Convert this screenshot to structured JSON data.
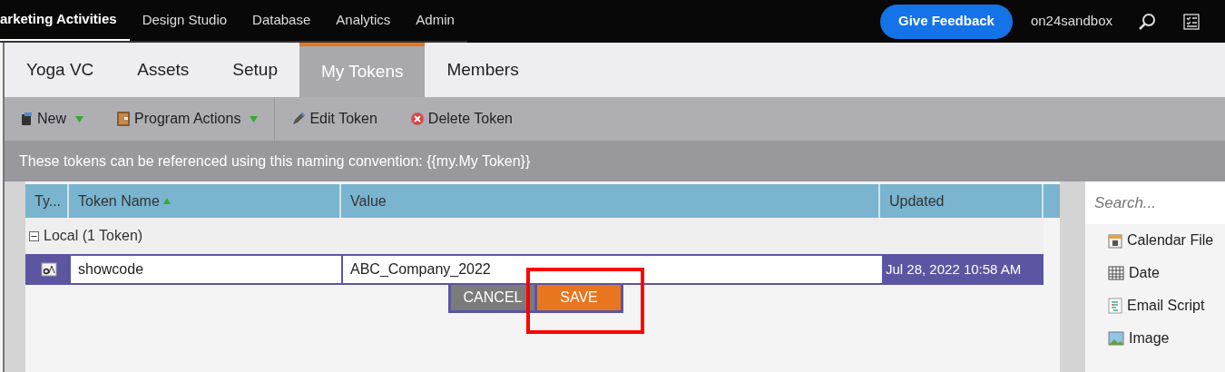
{
  "top_nav": {
    "items": [
      {
        "label": "arketing Activities",
        "selected": true
      },
      {
        "label": "Design Studio",
        "selected": false
      },
      {
        "label": "Database",
        "selected": false
      },
      {
        "label": "Analytics",
        "selected": false
      },
      {
        "label": "Admin",
        "selected": false
      }
    ],
    "feedback_button": "Give Feedback",
    "account": "on24sandbox"
  },
  "tabs": [
    {
      "label": "Yoga VC",
      "selected": false
    },
    {
      "label": "Assets",
      "selected": false
    },
    {
      "label": "Setup",
      "selected": false
    },
    {
      "label": "My Tokens",
      "selected": true
    },
    {
      "label": "Members",
      "selected": false
    }
  ],
  "toolbar": [
    {
      "label": "New",
      "kind": "new",
      "dropdown": true
    },
    {
      "label": "Program Actions",
      "kind": "actions",
      "dropdown": true
    },
    {
      "label": "Edit Token",
      "kind": "edit",
      "dropdown": false
    },
    {
      "label": "Delete Token",
      "kind": "delete",
      "dropdown": false
    }
  ],
  "info": "These tokens can be referenced using this naming convention: {{my.My Token}}",
  "table": {
    "columns": [
      "Ty...",
      "Token Name",
      "Value",
      "Updated"
    ],
    "group": {
      "label": "Local (1 Token)",
      "expanded": true
    },
    "rows": [
      {
        "name": "showcode",
        "value": "ABC_Company_2022",
        "updated": "Jul 28, 2022 10:58 AM",
        "selected": true
      }
    ],
    "buttons": [
      "CANCEL",
      "SAVE"
    ]
  },
  "sidebar": {
    "placeholder": "Search...",
    "items": [
      {
        "label": "Calendar File",
        "kind": "calendar"
      },
      {
        "label": "Date",
        "kind": "date"
      },
      {
        "label": "Email Script",
        "kind": "script"
      },
      {
        "label": "Image",
        "kind": "image"
      }
    ]
  }
}
